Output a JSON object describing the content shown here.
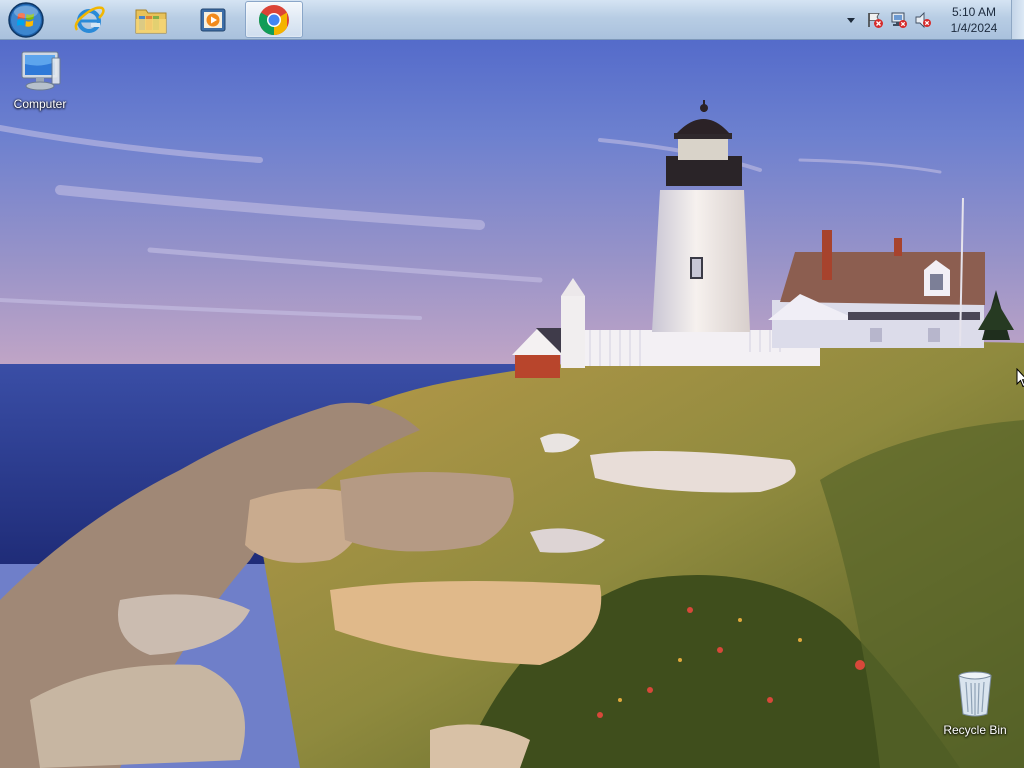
{
  "desktop": {
    "wallpaper": "lighthouse-coastal-sunset",
    "icons": [
      {
        "label": "Computer",
        "icon": "computer-icon"
      },
      {
        "label": "Recycle Bin",
        "icon": "recycle-bin-icon"
      }
    ]
  },
  "taskbar": {
    "start_button": {
      "icon": "windows-orb-icon"
    },
    "pinned": [
      {
        "name": "Internet Explorer",
        "icon": "internet-explorer-icon"
      },
      {
        "name": "Windows Explorer",
        "icon": "folder-library-icon"
      },
      {
        "name": "Windows Media Player",
        "icon": "media-player-icon"
      },
      {
        "name": "Google Chrome",
        "icon": "chrome-icon",
        "active": true
      }
    ],
    "tray": {
      "icons": [
        "show-hidden-icons-chevron",
        "action-center-flag-error-icon",
        "network-error-icon",
        "volume-muted-icon"
      ],
      "time": "5:10 AM",
      "date": "1/4/2024"
    }
  },
  "colors": {
    "taskbar_top": "#d5e4f3",
    "taskbar_bottom": "#a9c1dd",
    "sky_top": "#4f68c9",
    "sea": "#2f3f92"
  }
}
